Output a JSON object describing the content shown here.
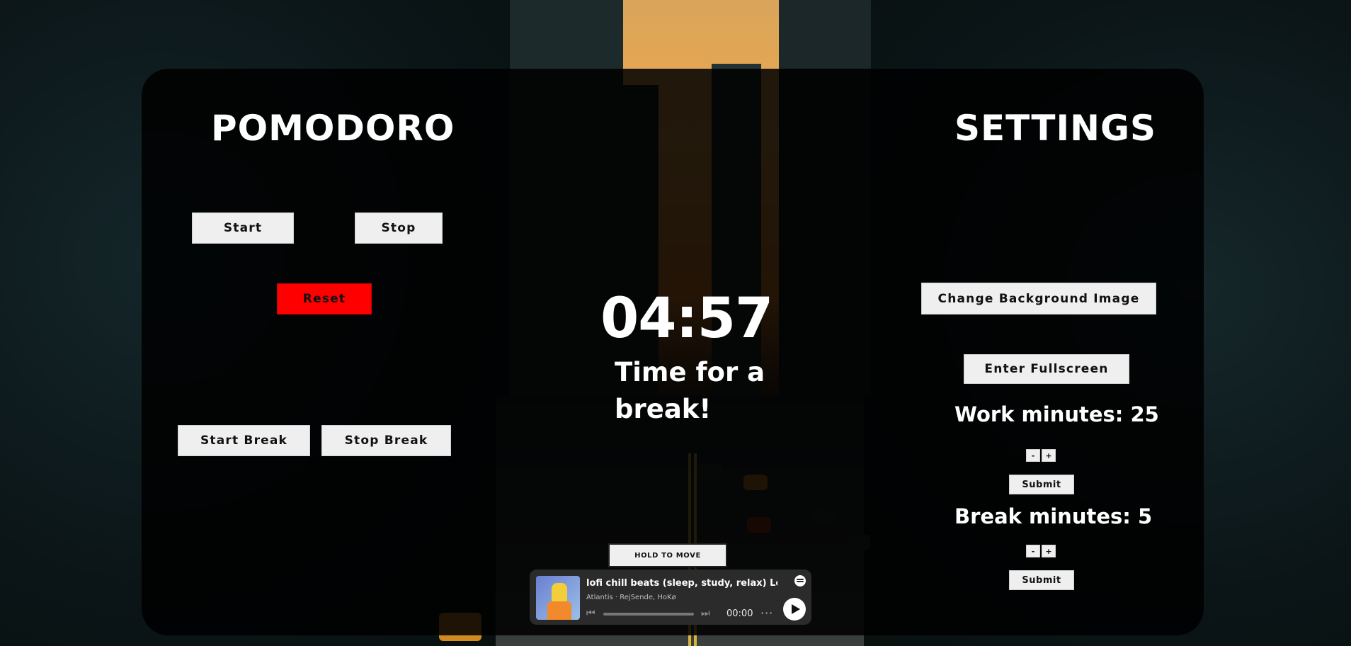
{
  "pomodoro": {
    "title": "POMODORO",
    "start_label": "Start",
    "stop_label": "Stop",
    "reset_label": "Reset",
    "start_break_label": "Start Break",
    "stop_break_label": "Stop Break",
    "timer_value": "04:57",
    "status_text": "Time for a break!"
  },
  "settings": {
    "title": "SETTINGS",
    "change_bg_label": "Change Background Image",
    "fullscreen_label": "Enter Fullscreen",
    "work_minutes_label": "Work minutes: 25",
    "break_minutes_label": "Break minutes: 5",
    "decrement_label": "-",
    "increment_label": "+",
    "submit_label": "Submit"
  },
  "widget": {
    "hold_label": "HOLD TO MOVE"
  },
  "player": {
    "song": "lofi chill beats (sleep, study, relax) Lo Fi |",
    "artist": "Atlantis · RejSende, HoKø",
    "time": "00:00",
    "more": "···",
    "prev_icon": "skip-back-icon",
    "next_icon": "skip-forward-icon",
    "play_icon": "play-icon",
    "brand_icon": "spotify-icon"
  },
  "colors": {
    "reset": "#ff0000",
    "panel": "#000000",
    "button": "#efefef"
  }
}
